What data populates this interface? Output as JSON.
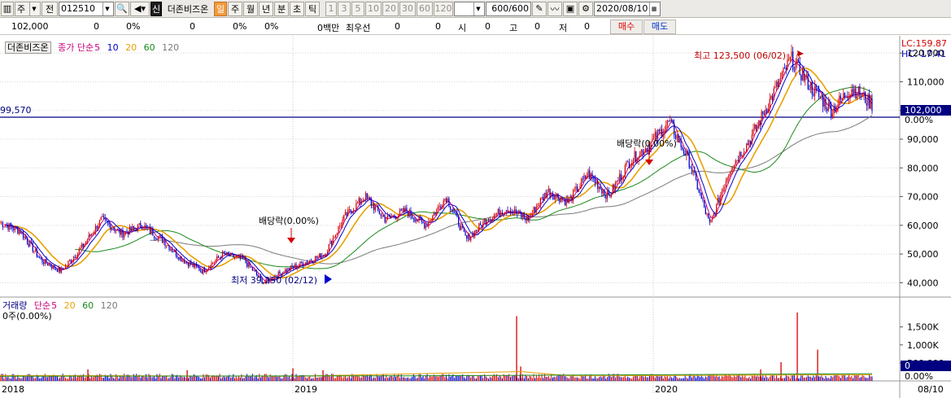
{
  "toolbar": {
    "period_type": "주",
    "prev_label": "전",
    "code": "012510",
    "company": "더존비즈온",
    "credit_label": "신",
    "periods": [
      "일",
      "주",
      "월",
      "년",
      "분",
      "초",
      "틱"
    ],
    "active_period": "일",
    "intervals": [
      "1",
      "3",
      "5",
      "10",
      "20",
      "30",
      "60",
      "120"
    ],
    "count": "600/600",
    "date": "2020/08/10"
  },
  "info_row": {
    "price": "102,000",
    "change": "0",
    "change_pct": "0%",
    "volume": "0",
    "pct1": "0%",
    "pct2": "0%",
    "amount": "0백만",
    "bid_label": "최우선",
    "bid1": "0",
    "bid2": "0",
    "open_label": "시",
    "open": "0",
    "high_label": "고",
    "high": "0",
    "low_label": "저",
    "low": "0",
    "buy_label": "매수",
    "sell_label": "매도"
  },
  "price_legend": {
    "name": "더존비즈온",
    "type": "종가 단순",
    "ma": [
      "5",
      "10",
      "20",
      "60",
      "120"
    ]
  },
  "volume_legend": {
    "name": "거래량",
    "type": "단순",
    "ma": [
      "5",
      "20",
      "60",
      "120"
    ],
    "value": "0주(0.00%)"
  },
  "colors": {
    "up": "#d40000",
    "down": "#0000cc",
    "ma5": "#c8007a",
    "ma10": "#0000cc",
    "ma20": "#e8a000",
    "ma60": "#1a8a1a",
    "ma120": "#7a7a7a"
  },
  "right_axis": {
    "lc": "LC:159.87",
    "hc": "HC:-17.41",
    "price_ticks": [
      "120,000",
      "110,000",
      "100,000",
      "90,000",
      "80,000",
      "70,000",
      "60,000",
      "50,000",
      "40,000"
    ],
    "current_price": "102,000",
    "current_pct": "0.00%",
    "volume_ticks": [
      "1,500K",
      "1,000K",
      "500,000"
    ],
    "volume_current": "0",
    "volume_pct": "0.00%"
  },
  "x_axis": [
    "2018",
    "2019",
    "2020",
    "08/10"
  ],
  "annotations": {
    "high": "최고 123,500 (06/02)",
    "low": "최저 39,250 (02/12)",
    "dividend1": "배당락(0.00%)",
    "dividend2": "배당락(0.00%)",
    "level_line": "99,570"
  },
  "chart_data": {
    "type": "candlestick",
    "x_range": [
      "2018",
      "08/10"
    ],
    "y_range": [
      35000,
      126000
    ],
    "y_ticks": [
      40000,
      50000,
      60000,
      70000,
      80000,
      90000,
      100000,
      110000,
      120000
    ],
    "current_price": 102000,
    "level_line": 99570,
    "close_trace": [
      61000,
      58000,
      48000,
      44000,
      52000,
      62000,
      57000,
      60000,
      55000,
      48000,
      44000,
      50000,
      48000,
      40000,
      44000,
      47000,
      50000,
      63000,
      70000,
      62000,
      65000,
      60000,
      70000,
      55000,
      62000,
      66000,
      62000,
      72000,
      68000,
      78000,
      70000,
      82000,
      88000,
      96000,
      82000,
      60000,
      80000,
      90000,
      104000,
      118000,
      108000,
      100000,
      108000,
      102000
    ],
    "annotations": [
      {
        "label": "최고 123,500 (06/02)",
        "value": 123500,
        "date": "06/02"
      },
      {
        "label": "최저 39,250 (02/12)",
        "value": 39250,
        "date": "02/12"
      }
    ],
    "volume": {
      "y_range": [
        0,
        1900000
      ],
      "y_ticks": [
        500000,
        1000000,
        1500000
      ],
      "spikes": [
        320000,
        300000,
        350000,
        300000,
        1800000,
        400000,
        320000,
        520000,
        1900000,
        870000
      ]
    }
  }
}
